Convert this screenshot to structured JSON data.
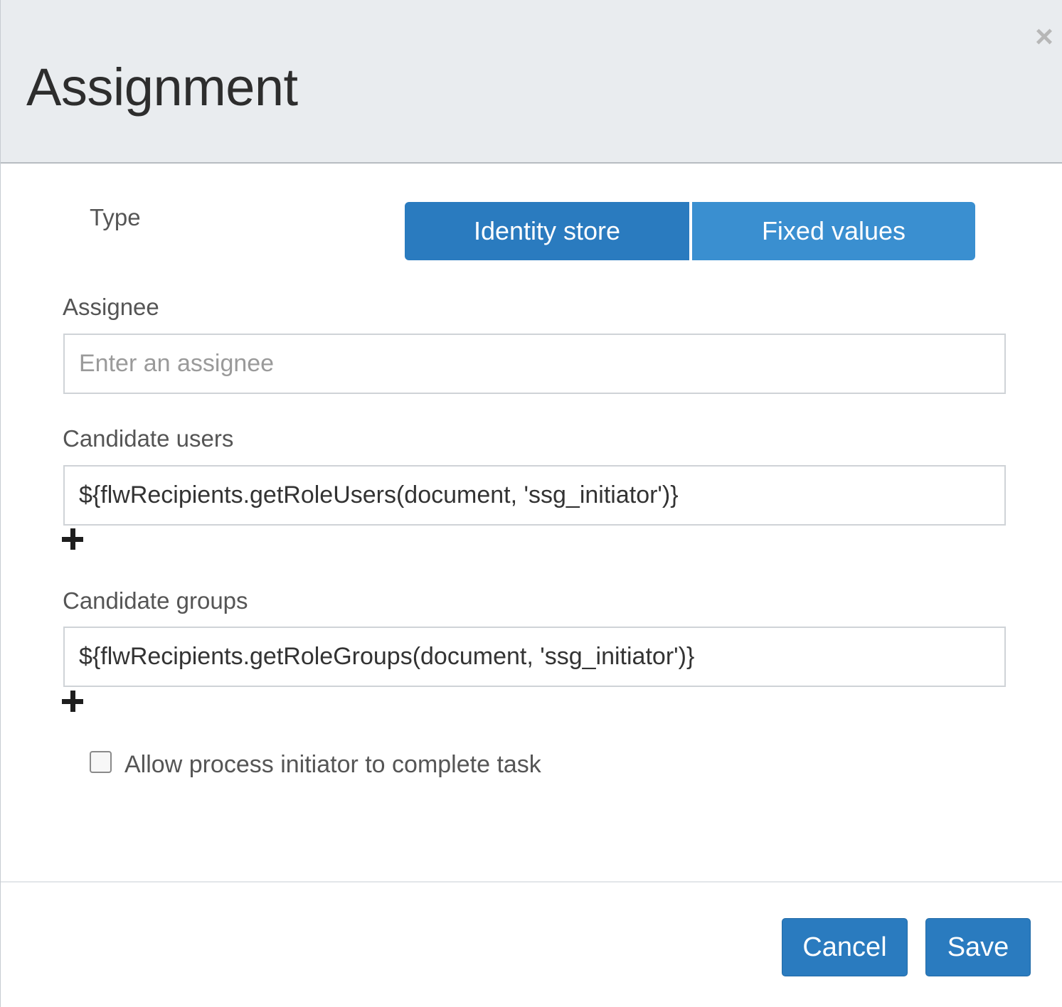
{
  "dialog": {
    "title": "Assignment",
    "close_icon": "close-icon",
    "close_glyph": "×"
  },
  "type_selector": {
    "label": "Type",
    "options": [
      "Identity store",
      "Fixed values"
    ],
    "colors": {
      "identity_store": "#2a7bbf",
      "fixed_values": "#3a8fd0"
    }
  },
  "assignee": {
    "label": "Assignee",
    "placeholder": "Enter an assignee",
    "value": ""
  },
  "candidate_users": {
    "label": "Candidate users",
    "value": "${flwRecipients.getRoleUsers(document, 'ssg_initiator')}",
    "add_icon": "plus-icon"
  },
  "candidate_groups": {
    "label": "Candidate groups",
    "value": "${flwRecipients.getRoleGroups(document, 'ssg_initiator')}",
    "add_icon": "plus-icon"
  },
  "allow_initiator": {
    "label": "Allow process initiator to complete task",
    "checked": false
  },
  "footer": {
    "cancel_label": "Cancel",
    "save_label": "Save",
    "accent_color": "#2a7bbf"
  }
}
